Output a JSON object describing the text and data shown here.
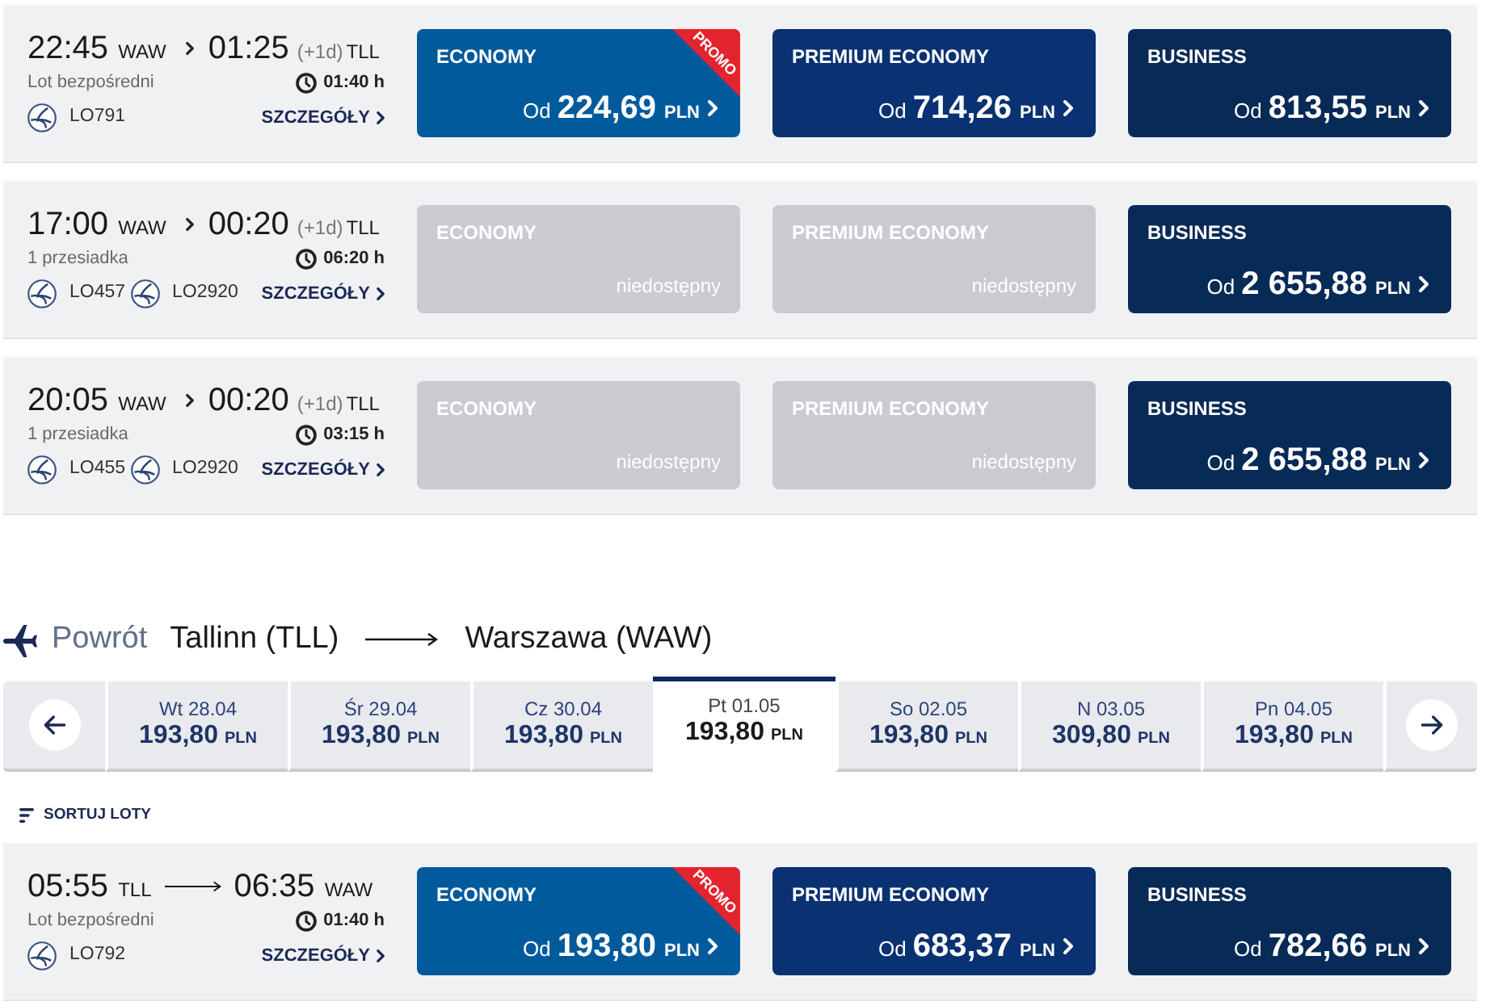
{
  "outbound_flights": [
    {
      "kind": "outbound",
      "departure": {
        "time": "22:45",
        "airport": "WAW"
      },
      "arrival": {
        "time": "01:25",
        "day_offset": "(+1d)",
        "airport": "TLL"
      },
      "stops": "Lot bezpośredni",
      "duration": "01:40 h",
      "flight_numbers": [
        "LO791"
      ],
      "details": "SZCZEGÓŁY",
      "fares": [
        {
          "kind": "price",
          "cabin": "ECONOMY",
          "color": "#005a9c",
          "promo": "PROMO",
          "prefix": "Od",
          "price": "224,69",
          "currency": "PLN"
        },
        {
          "kind": "price",
          "cabin": "PREMIUM ECONOMY",
          "color": "#0a3172",
          "prefix": "Od",
          "price": "714,26",
          "currency": "PLN"
        },
        {
          "kind": "price",
          "cabin": "BUSINESS",
          "color": "#082a56",
          "prefix": "Od",
          "price": "813,55",
          "currency": "PLN"
        }
      ]
    },
    {
      "kind": "outbound",
      "departure": {
        "time": "17:00",
        "airport": "WAW"
      },
      "arrival": {
        "time": "00:20",
        "day_offset": "(+1d)",
        "airport": "TLL"
      },
      "stops": "1 przesiadka",
      "duration": "06:20 h",
      "flight_numbers": [
        "LO457",
        "LO2920"
      ],
      "details": "SZCZEGÓŁY",
      "fares": [
        {
          "kind": "unavailable",
          "cabin": "ECONOMY",
          "status": "niedostępny"
        },
        {
          "kind": "unavailable",
          "cabin": "PREMIUM ECONOMY",
          "status": "niedostępny"
        },
        {
          "kind": "price",
          "cabin": "BUSINESS",
          "color": "#082a56",
          "prefix": "Od",
          "price": "2 655,88",
          "currency": "PLN"
        }
      ]
    },
    {
      "kind": "outbound",
      "departure": {
        "time": "20:05",
        "airport": "WAW"
      },
      "arrival": {
        "time": "00:20",
        "day_offset": "(+1d)",
        "airport": "TLL"
      },
      "stops": "1 przesiadka",
      "duration": "03:15 h",
      "flight_numbers": [
        "LO455",
        "LO2920"
      ],
      "details": "SZCZEGÓŁY",
      "fares": [
        {
          "kind": "unavailable",
          "cabin": "ECONOMY",
          "status": "niedostępny"
        },
        {
          "kind": "unavailable",
          "cabin": "PREMIUM ECONOMY",
          "status": "niedostępny"
        },
        {
          "kind": "price",
          "cabin": "BUSINESS",
          "color": "#082a56",
          "prefix": "Od",
          "price": "2 655,88",
          "currency": "PLN"
        }
      ]
    }
  ],
  "return_header": {
    "label": "Powrót",
    "origin": "Tallinn (TLL)",
    "destination": "Warszawa (WAW)"
  },
  "date_strip": {
    "dates": [
      {
        "day": "Wt 28.04",
        "price": "193,80",
        "currency": "PLN",
        "selected": false
      },
      {
        "day": "Śr 29.04",
        "price": "193,80",
        "currency": "PLN",
        "selected": false
      },
      {
        "day": "Cz 30.04",
        "price": "193,80",
        "currency": "PLN",
        "selected": false
      },
      {
        "day": "Pt 01.05",
        "price": "193,80",
        "currency": "PLN",
        "selected": true
      },
      {
        "day": "So 02.05",
        "price": "193,80",
        "currency": "PLN",
        "selected": false
      },
      {
        "day": "N 03.05",
        "price": "309,80",
        "currency": "PLN",
        "selected": false
      },
      {
        "day": "Pn 04.05",
        "price": "193,80",
        "currency": "PLN",
        "selected": false
      }
    ]
  },
  "sort": {
    "label": "SORTUJ LOTY"
  },
  "return_flights": [
    {
      "kind": "return",
      "departure": {
        "time": "05:55",
        "airport": "TLL"
      },
      "arrival": {
        "time": "06:35",
        "airport": "WAW"
      },
      "stops": "Lot bezpośredni",
      "duration": "01:40 h",
      "flight_numbers": [
        "LO792"
      ],
      "details": "SZCZEGÓŁY",
      "fares": [
        {
          "kind": "price",
          "cabin": "ECONOMY",
          "color": "#005a9c",
          "promo": "PROMO",
          "prefix": "Od",
          "price": "193,80",
          "currency": "PLN"
        },
        {
          "kind": "price",
          "cabin": "PREMIUM ECONOMY",
          "color": "#0a3172",
          "prefix": "Od",
          "price": "683,37",
          "currency": "PLN"
        },
        {
          "kind": "price",
          "cabin": "BUSINESS",
          "color": "#082a56",
          "prefix": "Od",
          "price": "782,66",
          "currency": "PLN"
        }
      ]
    }
  ]
}
